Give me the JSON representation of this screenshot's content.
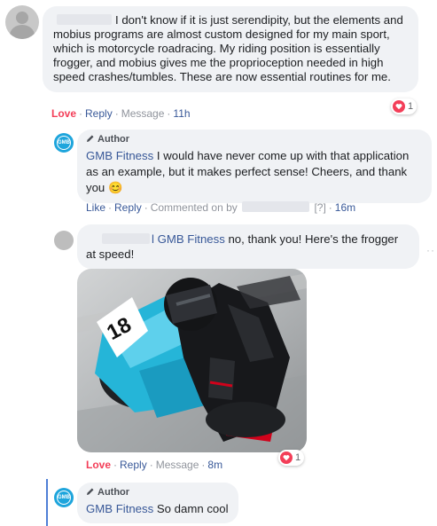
{
  "comment1": {
    "text": "I don't know if it is just serendipity, but the elements and mobius programs are almost custom designed for my main sport, which is motorcycle roadracing. My riding position is essentially frogger, and mobius gives me the proprioception needed in high speed crashes/tumbles. These are now essential routines for me.",
    "actions": {
      "love": "Love",
      "reply": "Reply",
      "message": "Message",
      "time": "11h"
    },
    "reaction_count": "1"
  },
  "reply1": {
    "author_badge": "Author",
    "name": "GMB Fitness",
    "text": "I would have never come up with that application as an example, but it makes perfect sense! Cheers, and thank you",
    "emoji": "😊",
    "actions": {
      "like": "Like",
      "reply": "Reply",
      "commented_on": "Commented on by",
      "unknown": "[?]",
      "time": "16m"
    }
  },
  "reply2": {
    "mention": "l GMB Fitness",
    "text": " no, thank you! Here's the frogger at speed!",
    "race_number": "18",
    "actions": {
      "love": "Love",
      "reply": "Reply",
      "message": "Message",
      "time": "8m"
    },
    "reaction_count": "1"
  },
  "reply3": {
    "author_badge": "Author",
    "name": "GMB Fitness",
    "text": "So damn cool"
  },
  "more_glyph": "··",
  "colors": {
    "link": "#385898",
    "love": "#f33e58",
    "accent_line": "#4f7fd6",
    "bubble": "#f0f2f5",
    "gmb_blue": "#1ea5dc"
  }
}
